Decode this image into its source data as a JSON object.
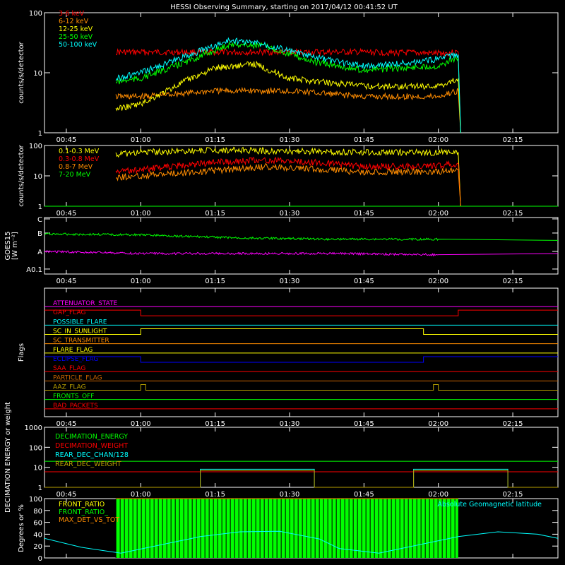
{
  "title": "HESSI Observing Summary, starting on 2017/04/12 00:41:52 UT",
  "colors": {
    "background": "#000000",
    "axes": "#ffffff",
    "red": "#ff0000",
    "orange": "#ff8c00",
    "yellow": "#ffff00",
    "green": "#00ff00",
    "cyan": "#00ffff",
    "magenta": "#ff00ff",
    "blue": "#0000ff",
    "olive": "#b8a000",
    "brown": "#c86400"
  },
  "time_axis": {
    "tick_labels": [
      "00:45",
      "01:00",
      "01:15",
      "01:30",
      "01:45",
      "02:00",
      "02:15"
    ],
    "tick_minutes": [
      45,
      60,
      75,
      90,
      105,
      120,
      135
    ],
    "range_minutes": [
      40.6,
      144.1
    ]
  },
  "chart_data": [
    {
      "type": "line",
      "id": "xray",
      "ylabel": "counts/s/detector",
      "ylog": true,
      "ylim": [
        1,
        100
      ],
      "ytick_labels": [
        "1",
        "10",
        "100"
      ],
      "ytick_values": [
        1,
        10,
        100
      ],
      "series": [
        {
          "name": "3-6 keV",
          "color": "red",
          "x_min": [
            55,
            60,
            75,
            90,
            105,
            120,
            124,
            124.5
          ],
          "y": [
            22,
            22,
            22,
            22,
            22,
            21,
            22,
            1
          ]
        },
        {
          "name": "6-12 keV",
          "color": "orange",
          "x_min": [
            55,
            60,
            75,
            90,
            105,
            120,
            124,
            124.5
          ],
          "y": [
            4,
            4,
            5,
            5,
            4,
            4,
            5,
            1
          ]
        },
        {
          "name": "12-25 keV",
          "color": "yellow",
          "x_min": [
            55,
            60,
            70,
            75,
            83,
            90,
            105,
            120,
            124,
            124.5
          ],
          "y": [
            2.5,
            3,
            8,
            12,
            14,
            8,
            6,
            6,
            8,
            1
          ]
        },
        {
          "name": "25-50 keV",
          "color": "green",
          "x_min": [
            55,
            60,
            70,
            78,
            85,
            95,
            105,
            120,
            124,
            124.5
          ],
          "y": [
            7,
            8,
            16,
            30,
            28,
            15,
            11,
            13,
            18,
            1
          ]
        },
        {
          "name": "50-100 keV",
          "color": "cyan",
          "x_min": [
            55,
            60,
            70,
            78,
            85,
            95,
            105,
            115,
            120,
            124,
            124.5
          ],
          "y": [
            8,
            10,
            20,
            35,
            30,
            18,
            13,
            15,
            17,
            20,
            1
          ]
        }
      ]
    },
    {
      "type": "line",
      "id": "gamma",
      "ylabel": "counts/s/detector",
      "ylog": true,
      "ylim": [
        1,
        100
      ],
      "ytick_labels": [
        "1",
        "10",
        "100"
      ],
      "ytick_values": [
        1,
        10,
        100
      ],
      "series": [
        {
          "name": "0.1-0.3 MeV",
          "color": "yellow",
          "x_min": [
            55,
            60,
            75,
            90,
            105,
            120,
            124,
            124.5
          ],
          "y": [
            50,
            60,
            70,
            65,
            60,
            58,
            60,
            1
          ]
        },
        {
          "name": "0.3-0.8 MeV",
          "color": "red",
          "x_min": [
            55,
            60,
            75,
            85,
            95,
            105,
            120,
            124,
            124.5
          ],
          "y": [
            14,
            16,
            28,
            33,
            28,
            20,
            22,
            25,
            1
          ]
        },
        {
          "name": "0.8-7 MeV",
          "color": "orange",
          "x_min": [
            55,
            60,
            75,
            85,
            95,
            105,
            120,
            124,
            124.5
          ],
          "y": [
            9,
            10,
            15,
            20,
            17,
            13,
            14,
            16,
            1
          ]
        },
        {
          "name": "7-20 MeV",
          "color": "green",
          "x_min": [
            40.6,
            144.1
          ],
          "y": [
            1,
            1
          ]
        }
      ]
    },
    {
      "type": "line",
      "id": "goes",
      "ylabel": "GOES15",
      "yunit": "[W m⁻²]",
      "ylog": true,
      "ylim": [
        0.4,
        5
      ],
      "ytick_labels": [
        "A0.1",
        "A",
        "B",
        "C"
      ],
      "ytick_values": [
        0.5,
        1.1,
        2.5,
        4.7
      ],
      "series": [
        {
          "color": "green",
          "x_min": [
            40.6,
            60,
            80,
            100,
            120,
            144.1
          ],
          "y": [
            2.4,
            2.3,
            2.0,
            1.9,
            1.9,
            1.8
          ]
        },
        {
          "color": "magenta",
          "x_min": [
            40.6,
            60,
            80,
            100,
            120,
            144.1
          ],
          "y": [
            1.1,
            1.0,
            1.0,
            1.0,
            0.95,
            1.0
          ]
        }
      ]
    },
    {
      "type": "line",
      "id": "flags",
      "ylabel": "Flags",
      "series": [
        {
          "name": "ATTENUATOR_STATE",
          "color": "magenta",
          "x_min": [
            40.6,
            144.1
          ],
          "y": [
            0,
            0
          ]
        },
        {
          "name": "GAP_FLAG",
          "color": "red",
          "x_min": [
            40.6,
            60,
            60,
            124,
            124,
            144.1
          ],
          "y": [
            1,
            1,
            0,
            0,
            1,
            1
          ]
        },
        {
          "name": "POSSIBLE_FLARE",
          "color": "cyan",
          "x_min": [
            40.6,
            144.1
          ],
          "y": [
            0,
            0
          ]
        },
        {
          "name": "SC_IN_SUNLIGHT",
          "color": "yellow",
          "x_min": [
            40.6,
            60,
            60,
            117,
            117,
            144.1
          ],
          "y": [
            0,
            0,
            1,
            1,
            0,
            0
          ]
        },
        {
          "name": "SC_TRANSMITTER",
          "color": "orange",
          "x_min": [
            40.6,
            144.1
          ],
          "y": [
            0,
            0
          ]
        },
        {
          "name": "FLARE_FLAG",
          "color": "yellow",
          "x_min": [
            40.6,
            144.1
          ],
          "y": [
            0,
            0
          ]
        },
        {
          "name": "ECLIPSE_FLAG",
          "color": "blue",
          "x_min": [
            40.6,
            60,
            60,
            117,
            117,
            144.1
          ],
          "y": [
            1,
            1,
            0,
            0,
            1,
            1
          ]
        },
        {
          "name": "SAA_FLAG",
          "color": "red",
          "x_min": [
            40.6,
            144.1
          ],
          "y": [
            0,
            0
          ]
        },
        {
          "name": "PARTICLE_FLAG",
          "color": "brown",
          "x_min": [
            40.6,
            144.1
          ],
          "y": [
            0,
            0
          ]
        },
        {
          "name": "AAZ_FLAG",
          "color": "olive",
          "x_min": [
            40.6,
            60,
            60,
            61,
            61,
            119,
            119,
            120,
            120,
            144.1
          ],
          "y": [
            0,
            0,
            1,
            1,
            0,
            0,
            1,
            1,
            0,
            0
          ]
        },
        {
          "name": "FRONTS_OFF",
          "color": "green",
          "x_min": [
            40.6,
            144.1
          ],
          "y": [
            0,
            0
          ]
        },
        {
          "name": "BAD_PACKETS",
          "color": "red",
          "x_min": [
            40.6,
            144.1
          ],
          "y": [
            0,
            0
          ]
        }
      ]
    },
    {
      "type": "line",
      "id": "decimation",
      "ylabel": "DECIMATION ENERGY or weight",
      "ylog": true,
      "ylim": [
        1,
        1000
      ],
      "ytick_labels": [
        "1",
        "10",
        "100",
        "1000"
      ],
      "ytick_values": [
        1,
        10,
        100,
        1000
      ],
      "series": [
        {
          "name": "DECIMATION_ENERGY",
          "color": "green",
          "x_min": [
            40.6,
            144.1
          ],
          "y": [
            20,
            20
          ]
        },
        {
          "name": "DECIMATION_WEIGHT",
          "color": "red",
          "x_min": [
            40.6,
            144.1
          ],
          "y": [
            6,
            6
          ]
        },
        {
          "name": "REAR_DEC_CHAN/128",
          "color": "cyan",
          "x_min": [
            40.6,
            72,
            72,
            95,
            95,
            115,
            115,
            134,
            134,
            144.1
          ],
          "y": [
            1,
            1,
            8,
            8,
            1,
            1,
            8,
            8,
            1,
            1
          ]
        },
        {
          "name": "REAR_DEC_WEIGHT",
          "color": "olive",
          "x_min": [
            40.6,
            72,
            72,
            95,
            95,
            115,
            115,
            134,
            134,
            144.1
          ],
          "y": [
            1,
            1,
            7,
            7,
            1,
            1,
            7,
            7,
            1,
            1
          ]
        }
      ]
    },
    {
      "type": "line",
      "id": "ratio",
      "ylabel": "Degrees or %",
      "ylim": [
        0,
        100
      ],
      "ytick_labels": [
        "0",
        "20",
        "40",
        "60",
        "80",
        "100"
      ],
      "ytick_values": [
        0,
        20,
        40,
        60,
        80,
        100
      ],
      "series": [
        {
          "name": "FRONT_RATIO",
          "color": "yellow",
          "x_min": [
            55,
            124
          ],
          "y": [
            100,
            100
          ]
        },
        {
          "name": "FRONT_RATIO_",
          "color": "green",
          "x_min": [
            55,
            124
          ],
          "y": [
            100,
            100
          ]
        },
        {
          "name": "MAX_DET_VS_TOT",
          "color": "orange",
          "x_min": [
            55,
            124
          ],
          "y": [
            100,
            100
          ]
        },
        {
          "name": "Absolute Geomagnetic latitude",
          "color": "cyan",
          "x_min": [
            40.6,
            48,
            56,
            64,
            72,
            80,
            88,
            96,
            100,
            108,
            116,
            124,
            132,
            140,
            144.1
          ],
          "y": [
            33,
            18,
            8,
            22,
            36,
            44,
            45,
            32,
            16,
            8,
            22,
            36,
            44,
            40,
            33
          ]
        }
      ]
    }
  ]
}
